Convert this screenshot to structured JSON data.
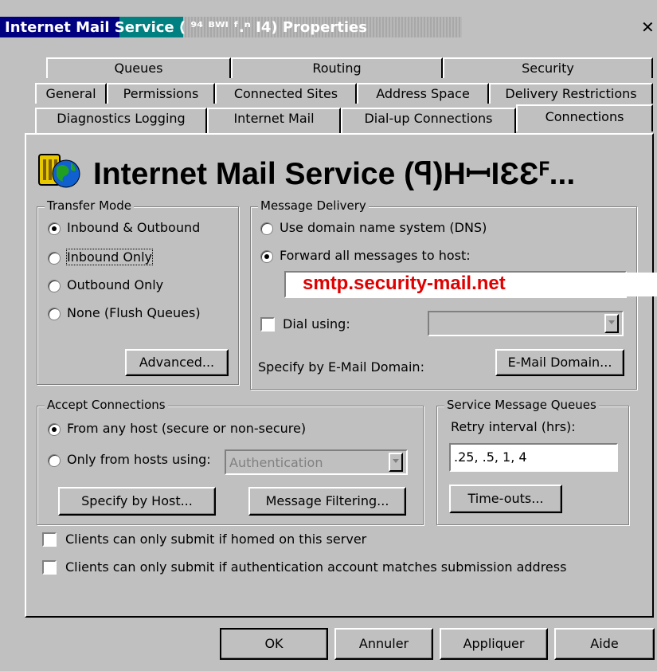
{
  "window": {
    "title": "Internet Mail Service (   ⁹⁴ ᴮᵂᴵ ᶠ.ⁿ I4) Properties",
    "title_left": "Internet Mail",
    "title_mid": "Service (",
    "title_rest": "⁹⁴ ᴮᵂᴵ ᶠ.ⁿ I4) Properties",
    "close": "✕"
  },
  "tabs": {
    "row1": [
      "Queues",
      "Routing",
      "Security"
    ],
    "row2": [
      "General",
      "Permissions",
      "Connected Sites",
      "Address Space",
      "Delivery Restrictions"
    ],
    "row3": [
      "Diagnostics Logging",
      "Internet Mail",
      "Dial-up Connections",
      "Connections"
    ],
    "active": "Connections"
  },
  "header": {
    "title": "Internet Mail Service (ꟼ)HꟷIƐƐꟳ..."
  },
  "transfer_mode": {
    "legend": "Transfer Mode",
    "options": [
      "Inbound & Outbound",
      "Inbound Only",
      "Outbound Only",
      "None (Flush Queues)"
    ],
    "selected": 0,
    "advanced_button": "Advanced..."
  },
  "message_delivery": {
    "legend": "Message Delivery",
    "dns_option": "Use domain name system (DNS)",
    "forward_option": "Forward all messages to host:",
    "host_value": "smtp.security-mail.net",
    "dial_label": "Dial using:",
    "dial_value": "",
    "specify_label": "Specify by E-Mail Domain:",
    "email_domain_button": "E-Mail Domain..."
  },
  "accept_connections": {
    "legend": "Accept Connections",
    "any_host": "From any host (secure or non-secure)",
    "only_from": "Only from hosts using:",
    "auth_value": "Authentication",
    "specify_host_button": "Specify by Host...",
    "message_filtering_button": "Message Filtering..."
  },
  "service_queues": {
    "legend": "Service Message Queues",
    "retry_label": "Retry interval (hrs):",
    "retry_value": ".25, .5, 1, 4",
    "timeouts_button": "Time-outs..."
  },
  "checkboxes": {
    "homed": "Clients can only submit if homed on this server",
    "auth_match": "Clients can only submit if authentication account matches submission address"
  },
  "footer": {
    "ok": "OK",
    "cancel": "Annuler",
    "apply": "Appliquer",
    "help": "Aide"
  },
  "colors": {
    "title_active": "#000080",
    "title_accent": "#008080",
    "face": "#c0c0c0",
    "highlight_text": "#e00000"
  }
}
